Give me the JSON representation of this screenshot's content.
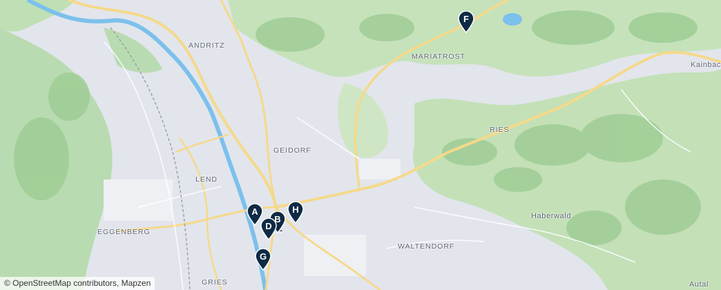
{
  "places": {
    "andritz": "ANDRITZ",
    "mariatrost": "MARIATROST",
    "kainbach": "Kainbach",
    "ries": "RIES",
    "geidorf": "GEIDORF",
    "lend": "LEND",
    "eggenberg": "EGGENBERG",
    "haberwald": "Haberwald",
    "waltendorf": "WALTENDORF",
    "gries": "GRIES",
    "autal": "Autal",
    "city_partial": "Z"
  },
  "markers": {
    "a": "A",
    "b": "B",
    "d": "D",
    "f": "F",
    "g": "G",
    "h": "H"
  },
  "attribution": "© OpenStreetMap contributors, Mapzen",
  "colors": {
    "marker": "#0f2a44",
    "river": "#6fb6e8",
    "road": "#f4d98a",
    "forest": "#a9d4a0"
  }
}
